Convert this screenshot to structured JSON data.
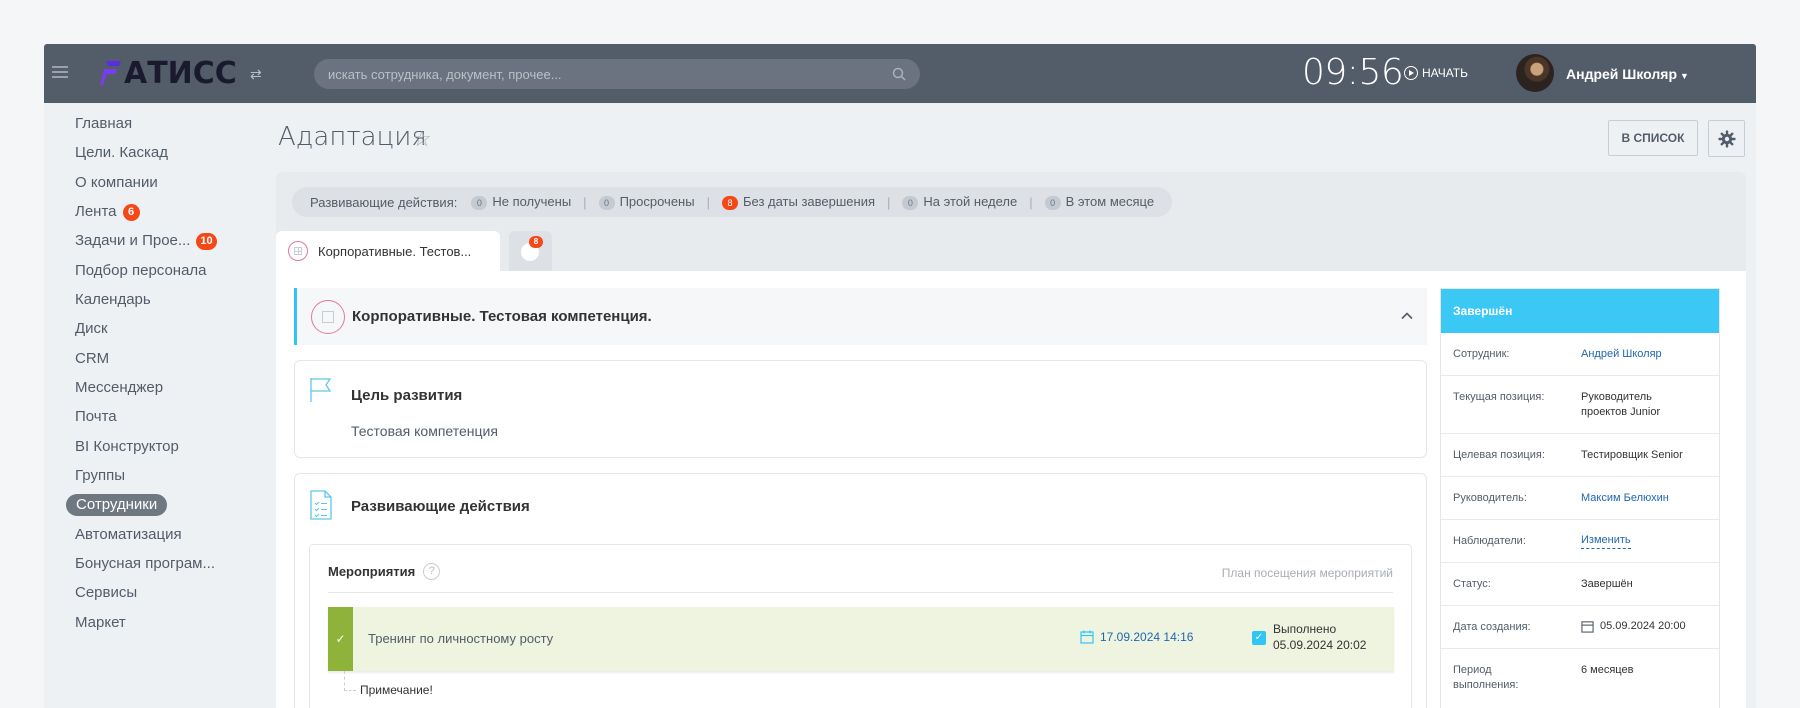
{
  "header": {
    "logo_text": "АТИСС",
    "search_placeholder": "искать сотрудника, документ, прочее...",
    "clock": "09:56",
    "start_label": "НАЧАТЬ",
    "user_name": "Андрей Школяр"
  },
  "sidebar": {
    "items": [
      {
        "label": "Главная"
      },
      {
        "label": "Цели. Каскад"
      },
      {
        "label": "О компании"
      },
      {
        "label": "Лента",
        "badge": "6"
      },
      {
        "label": "Задачи и Прое...",
        "badge": "10"
      },
      {
        "label": "Подбор персонала"
      },
      {
        "label": "Календарь"
      },
      {
        "label": "Диск"
      },
      {
        "label": "CRM"
      },
      {
        "label": "Мессенджер"
      },
      {
        "label": "Почта"
      },
      {
        "label": "BI Конструктор"
      },
      {
        "label": "Группы"
      },
      {
        "label": "Сотрудники",
        "active": true
      },
      {
        "label": "Автоматизация"
      },
      {
        "label": "Бонусная програм..."
      },
      {
        "label": "Сервисы"
      },
      {
        "label": "Маркет"
      }
    ]
  },
  "page": {
    "title": "Адаптация",
    "to_list_button": "В СПИСОК"
  },
  "filters": {
    "label": "Развивающие действия:",
    "items": [
      {
        "count": "0",
        "label": "Не получены"
      },
      {
        "count": "0",
        "label": "Просрочены"
      },
      {
        "count": "8",
        "label": "Без даты завершения",
        "highlight": true
      },
      {
        "count": "0",
        "label": "На этой неделе"
      },
      {
        "count": "0",
        "label": "В этом месяце"
      }
    ]
  },
  "tabs": {
    "tab1_label": "Корпоративные. Тестов...",
    "tab2_badge": "8"
  },
  "section": {
    "title": "Корпоративные. Тестовая компетенция.",
    "goal_title": "Цель развития",
    "goal_value": "Тестовая компетенция",
    "actions_title": "Развивающие действия",
    "events_header": "Мероприятия",
    "events_help": "?",
    "events_plan": "План посещения мероприятий",
    "event": {
      "name": "Тренинг по личностному росту",
      "date": "17.09.2024 14:16",
      "status_line1": "Выполнено",
      "status_line2": "05.09.2024 20:02"
    },
    "note": "Примечание!"
  },
  "details": {
    "status_header": "Завершён",
    "rows": [
      {
        "label": "Сотрудник:",
        "value": "Андрей Школяр"
      },
      {
        "label": "Текущая позиция:",
        "value": "Руководитель проектов Junior"
      },
      {
        "label": "Целевая позиция:",
        "value": "Тестировщик Senior"
      },
      {
        "label": "Руководитель:",
        "value": "Максим Белюхин"
      },
      {
        "label": "Наблюдатели:",
        "value": "Изменить"
      },
      {
        "label": "Статус:",
        "value": "Завершён"
      },
      {
        "label": "Дата создания:",
        "value": "05.09.2024 20:00"
      },
      {
        "label": "Период выполнения:",
        "value": "6 месяцев"
      }
    ]
  },
  "colors": {
    "topbar": "#535c69",
    "accent": "#2fc6f6",
    "badge_red": "#f54819",
    "done_green": "#8fb33a",
    "link": "#2067b0"
  }
}
